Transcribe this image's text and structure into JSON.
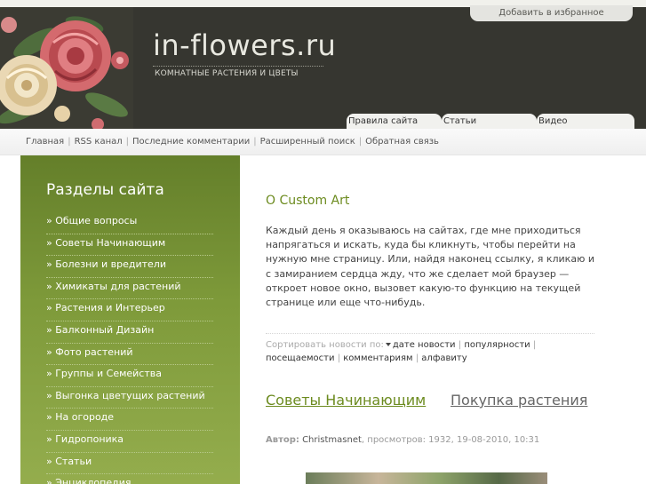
{
  "header": {
    "title": "in-flowers.ru",
    "slogan": "КОМНАТНЫЕ РАСТЕНИЯ И ЦВЕТЫ",
    "favorite_label": "Добавить в избранное",
    "tabs": [
      {
        "label": "Правила сайта"
      },
      {
        "label": "Статьи"
      },
      {
        "label": "Видео"
      }
    ]
  },
  "nav": {
    "links": [
      {
        "label": "Главная"
      },
      {
        "label": "RSS канал"
      },
      {
        "label": "Последние комментарии"
      },
      {
        "label": "Расширенный поиск"
      },
      {
        "label": "Обратная связь"
      }
    ],
    "separator": "|"
  },
  "sidebar": {
    "title": "Разделы сайта",
    "items": [
      {
        "label": "» Общие вопросы"
      },
      {
        "label": "» Советы Начинающим"
      },
      {
        "label": "» Болезни и вредители"
      },
      {
        "label": "» Химикаты для растений"
      },
      {
        "label": "» Растения и Интерьер"
      },
      {
        "label": "» Балконный Дизайн"
      },
      {
        "label": "» Фото растений"
      },
      {
        "label": "» Группы и Семейства"
      },
      {
        "label": "» Выгонка цветущих растений"
      },
      {
        "label": "» На огороде"
      },
      {
        "label": "» Гидропоника"
      },
      {
        "label": "» Статьи"
      },
      {
        "label": "» Энциклопедия"
      }
    ]
  },
  "main": {
    "title": "O Custom Art",
    "text": "Каждый день я оказываюсь на сайтах, где мне приходиться напрягаться и искать, куда бы кликнуть, чтобы перейти на нужную мне страницу. Или, найдя наконец ссылку, я кликаю и с замиранием сердца жду, что же сделает мой браузер — откроет новое окно, вызовет какую-то функцию на текущей странице или еще что-нибудь.",
    "sort": {
      "label": "Сортировать новости по:",
      "options": [
        {
          "label": "дате новости"
        },
        {
          "label": "популярности"
        },
        {
          "label": "посещаемости"
        },
        {
          "label": "комментариям"
        },
        {
          "label": "алфавиту"
        }
      ]
    },
    "news": [
      {
        "title": "Советы Начинающим"
      },
      {
        "title": "Покупка растения"
      }
    ],
    "meta": {
      "author_label": "Автор:",
      "author": "Christmasnet",
      "views_text": ", просмотров: 1932, 19-08-2010, 10:31"
    }
  },
  "colors": {
    "header_bg": "#363630",
    "accent_green": "#6c8b1f",
    "sidebar_top": "#647f2a",
    "sidebar_bottom": "#94ad4d"
  }
}
